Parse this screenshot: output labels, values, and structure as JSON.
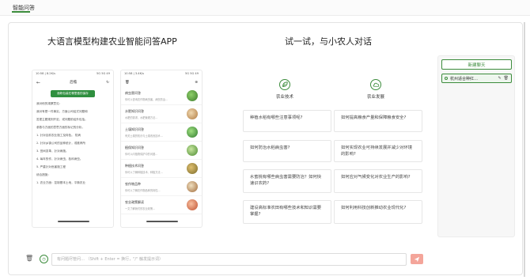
{
  "topbar": {
    "title": "智能问答"
  },
  "hero": {
    "title": "大语言模型构建农业智能问答APP"
  },
  "chat": {
    "title": "试一试，与小农人对话"
  },
  "phone_left": {
    "status_time": "10:58 | 8.2K/s",
    "status_right": "5G 5G 49",
    "header_title": "后檐",
    "green_button": "面粉包装在哪里做的保存",
    "lines": [
      "我对他的观察意见:",
      "我对有是一件事实，方面公司给式问题和",
      "答更主题规则开定，或问题前给外包括。",
      "参数与方面的意思方面的标记的分析。",
      "1. 针对目前农业施工及特色。 防病",
      "2. 针对乡镇公司的品种统计，或推荐所",
      "3. 田间变革，针对病施。",
      "4. 每年的作，针对病虫，各科病虫。",
      "5. 严重针对危害施工程",
      "综合措施：",
      "1. 农业方面：控制基本土地，平衡农业"
    ]
  },
  "phone_right": {
    "status_time": "10:58 | 3.4K/s",
    "status_right": "5G 5G 49",
    "items": [
      {
        "title": "病虫害问答",
        "desc": "你可以咨询农作物病虫害，病虫防治…"
      },
      {
        "title": "水肥知识问答",
        "desc": "水肥的需求，水肥管理方法…"
      },
      {
        "title": "土壤知识问答",
        "desc": "有关土壤的知识与土壤改良技术…"
      },
      {
        "title": "植保知识问答",
        "desc": "你可以问植物保护中的问题…"
      },
      {
        "title": "种植技术问答",
        "desc": "你可以了解种植技术、种植方法…"
      },
      {
        "title": "农作物品种",
        "desc": "你可以了解农作物品种的特性…"
      },
      {
        "title": "农业政策解读",
        "desc": "一文了解我们的农业政策…"
      }
    ]
  },
  "categories": [
    {
      "label": "农业技术",
      "icon": "leaf-icon"
    },
    {
      "label": "农业发展",
      "icon": "cloud-icon"
    }
  ],
  "questions": [
    "种植水稻有哪些注意事项呢?",
    "如何提高粮食产量和保障粮食安全?",
    "如何防治水稻病虫害?",
    "如何实现农业可持续发展并减少对环境的影响?",
    "水蜜桃有哪些病虫害需要防治？如何快速识农药?",
    "如何应对气候变化对农业生产的影响?",
    "建设高标准农田有哪些技术和知识需要掌握?",
    "如何利用科技创新推动农业现代化?"
  ],
  "sidebar": {
    "new_chat_label": "新建聊天",
    "history": [
      {
        "name": "杭州适合种红…"
      }
    ]
  },
  "input": {
    "placeholder": "有问题尽管问… （Shift + Enter = 换行，\"/\" 触发提示词）"
  },
  "colors": {
    "accent": "#3c8c3c",
    "send": "#f4a59a"
  }
}
